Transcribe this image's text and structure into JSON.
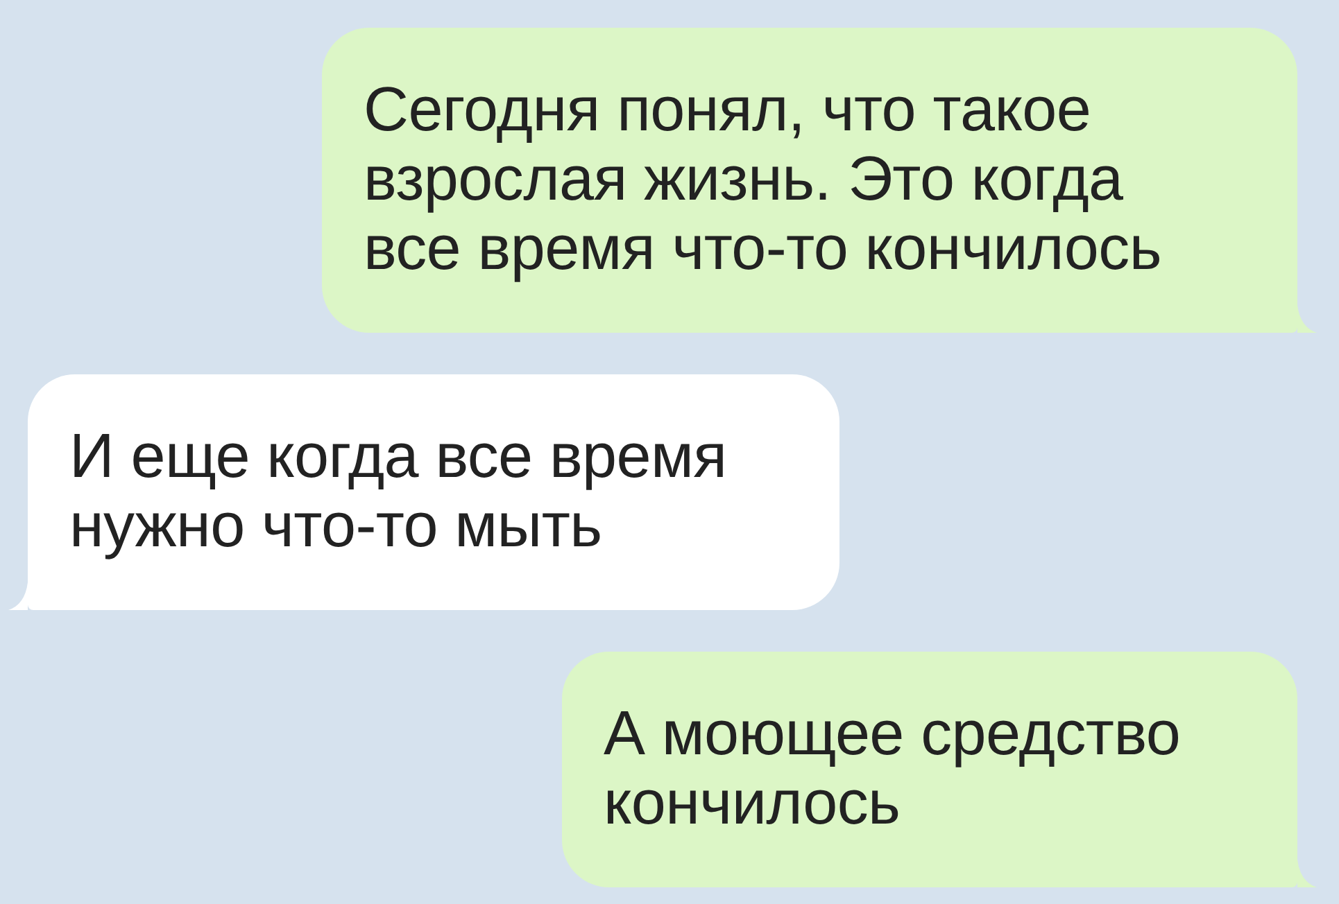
{
  "messages": [
    {
      "kind": "outgoing",
      "lines": [
        "Сегодня понял, что такое",
        "взрослая жизнь. Это когда",
        "все время что-то кончилось"
      ]
    },
    {
      "kind": "incoming",
      "lines": [
        "И еще когда все время",
        "нужно что-то мыть"
      ]
    },
    {
      "kind": "outgoing",
      "lines": [
        "А моющее средство",
        "кончилось"
      ]
    }
  ]
}
